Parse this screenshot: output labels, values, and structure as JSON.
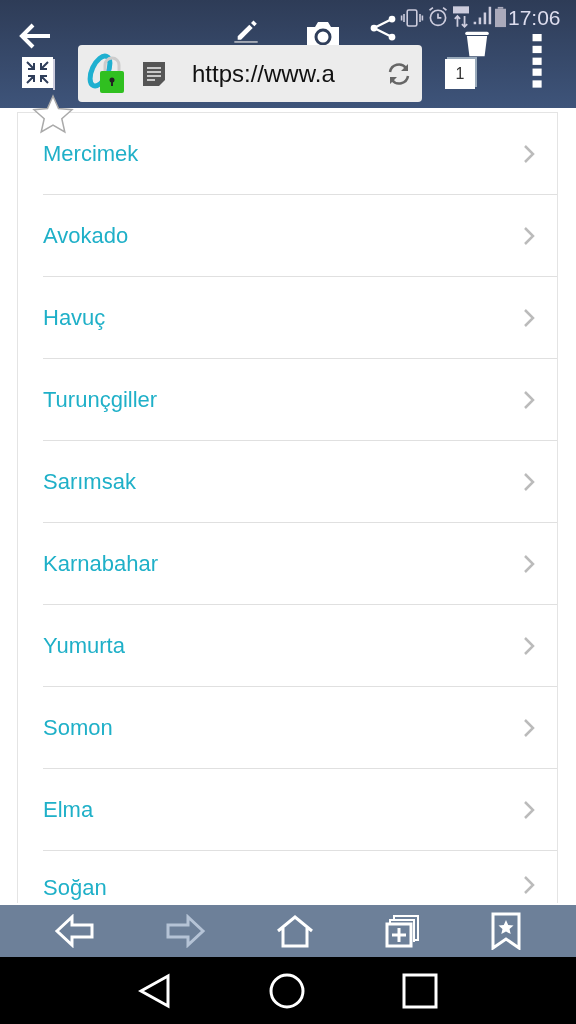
{
  "status_bar": {
    "time": "17:06"
  },
  "browser": {
    "url": "https://www.a",
    "tab_count": "1"
  },
  "items": [
    {
      "label": "Mercimek"
    },
    {
      "label": "Avokado"
    },
    {
      "label": "Havuç"
    },
    {
      "label": "Turunçgiller"
    },
    {
      "label": "Sarımsak"
    },
    {
      "label": "Karnabahar"
    },
    {
      "label": "Yumurta"
    },
    {
      "label": "Somon"
    },
    {
      "label": "Elma"
    },
    {
      "label": "Soğan"
    }
  ],
  "toolbar": [
    {
      "kind": "back",
      "disabled": false
    },
    {
      "kind": "forward",
      "disabled": true
    },
    {
      "kind": "home",
      "disabled": false
    },
    {
      "kind": "new-tab",
      "disabled": false
    },
    {
      "kind": "bookmarks",
      "disabled": false
    }
  ]
}
